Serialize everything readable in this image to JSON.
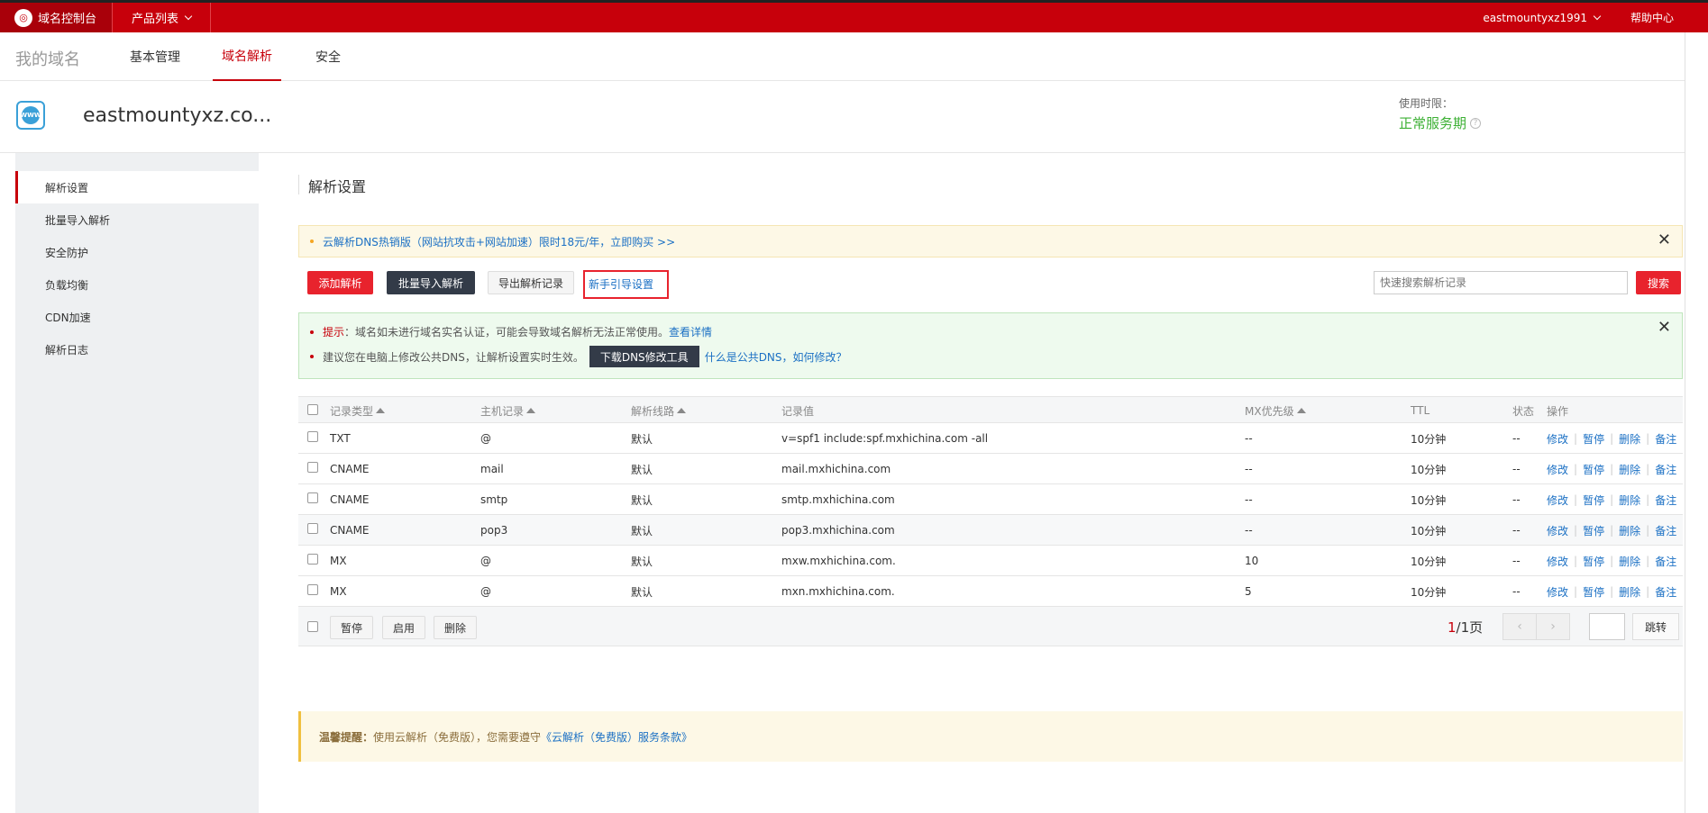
{
  "topbar": {
    "logo_text": "域名控制台",
    "products_label": "产品列表",
    "user": "eastmountyxz1991",
    "help": "帮助中心"
  },
  "subnav": {
    "title": "我的域名",
    "tabs": [
      {
        "label": "基本管理"
      },
      {
        "label": "域名解析"
      },
      {
        "label": "安全"
      }
    ]
  },
  "domain": {
    "name": "eastmountyxz.co...",
    "usage_label": "使用时限：",
    "status": "正常服务期",
    "icon_text": "WWW"
  },
  "sidebar": {
    "items": [
      {
        "label": "解析设置"
      },
      {
        "label": "批量导入解析"
      },
      {
        "label": "安全防护"
      },
      {
        "label": "负载均衡"
      },
      {
        "label": "CDN加速"
      },
      {
        "label": "解析日志"
      }
    ]
  },
  "main": {
    "title": "解析设置",
    "promo": "云解析DNS热销版（网站抗攻击+网站加速）限时18元/年，立即购买 >>",
    "buttons": {
      "add": "添加解析",
      "batch": "批量导入解析",
      "export": "导出解析记录",
      "guide": "新手引导设置",
      "search": "搜索"
    },
    "search_placeholder": "快速搜索解析记录",
    "tips": {
      "line1_label": "提示",
      "line1_text": "：域名如未进行域名实名认证，可能会导致域名解析无法正常使用。",
      "line1_link": "查看详情",
      "line2_text": "建议您在电脑上修改公共DNS，让解析设置实时生效。",
      "line2_button": "下载DNS修改工具",
      "line2_link": "什么是公共DNS，如何修改？"
    }
  },
  "table": {
    "headers": {
      "type": "记录类型",
      "host": "主机记录",
      "line": "解析线路",
      "value": "记录值",
      "mx": "MX优先级",
      "ttl": "TTL",
      "status": "状态",
      "ops": "操作"
    },
    "rows": [
      {
        "type": "TXT",
        "host": "@",
        "line": "默认",
        "value": "v=spf1 include:spf.mxhichina.com -all",
        "mx": "--",
        "ttl": "10分钟",
        "status": "--"
      },
      {
        "type": "CNAME",
        "host": "mail",
        "line": "默认",
        "value": "mail.mxhichina.com",
        "mx": "--",
        "ttl": "10分钟",
        "status": "--"
      },
      {
        "type": "CNAME",
        "host": "smtp",
        "line": "默认",
        "value": "smtp.mxhichina.com",
        "mx": "--",
        "ttl": "10分钟",
        "status": "--"
      },
      {
        "type": "CNAME",
        "host": "pop3",
        "line": "默认",
        "value": "pop3.mxhichina.com",
        "mx": "--",
        "ttl": "10分钟",
        "status": "--"
      },
      {
        "type": "MX",
        "host": "@",
        "line": "默认",
        "value": "mxw.mxhichina.com.",
        "mx": "10",
        "ttl": "10分钟",
        "status": "--"
      },
      {
        "type": "MX",
        "host": "@",
        "line": "默认",
        "value": "mxn.mxhichina.com.",
        "mx": "5",
        "ttl": "10分钟",
        "status": "--"
      }
    ],
    "ops": {
      "edit": "修改",
      "pause": "暂停",
      "delete": "删除",
      "note": "备注"
    },
    "footer": {
      "pause": "暂停",
      "enable": "启用",
      "delete": "删除",
      "page_current": "1",
      "page_total": "/1页",
      "jump": "跳转"
    }
  },
  "notice": {
    "label": "温馨提醒：",
    "text": "使用云解析（免费版），您需要遵守",
    "link": "《云解析（免费版）服务条款》"
  },
  "colors": {
    "brand_red": "#c7000b",
    "status_green": "#3cb034",
    "link_blue": "#1b70c4"
  }
}
